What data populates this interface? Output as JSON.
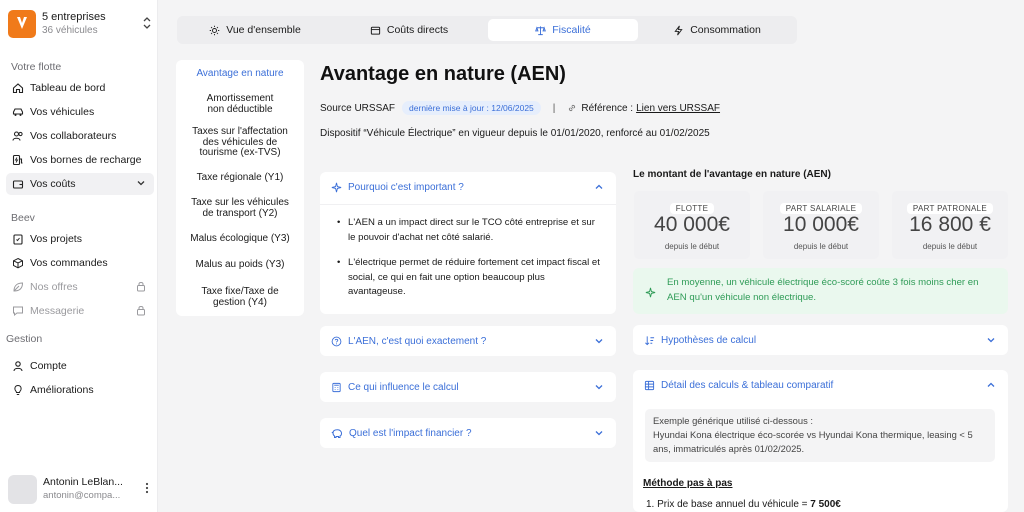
{
  "org": {
    "name": "5 entreprises",
    "sub": "36 véhicules"
  },
  "sidebar": {
    "section1": "Votre flotte",
    "items1": [
      {
        "label": "Tableau de bord",
        "icon": "home-icon"
      },
      {
        "label": "Vos véhicules",
        "icon": "car-icon"
      },
      {
        "label": "Vos collaborateurs",
        "icon": "users-icon"
      },
      {
        "label": "Vos bornes de recharge",
        "icon": "charger-icon"
      },
      {
        "label": "Vos coûts",
        "icon": "wallet-icon"
      }
    ],
    "section2": "Beev",
    "items2": [
      {
        "label": "Vos projets",
        "icon": "clipboard-icon"
      },
      {
        "label": "Vos commandes",
        "icon": "box-icon"
      },
      {
        "label": "Nos offres",
        "icon": "leaf-icon"
      },
      {
        "label": "Messagerie",
        "icon": "chat-icon"
      }
    ],
    "section3": "Gestion",
    "items3": [
      {
        "label": "Compte",
        "icon": "user-icon"
      },
      {
        "label": "Améliorations",
        "icon": "bulb-icon"
      }
    ]
  },
  "user": {
    "name": "Antonin LeBlan...",
    "email": "antonin@compa..."
  },
  "tabs": [
    {
      "label": "Vue d'ensemble"
    },
    {
      "label": "Coûts directs"
    },
    {
      "label": "Fiscalité"
    },
    {
      "label": "Consommation"
    }
  ],
  "subnav": [
    "Avantage en nature",
    "Amortissement non déductible",
    "Taxes sur l'affectation des véhicules de tourisme (ex-TVS)",
    "Taxe régionale (Y1)",
    "Taxe sur les véhicules de transport (Y2)",
    "Malus écologique (Y3)",
    "Malus au poids (Y3)",
    "Taxe fixe/Taxe de gestion (Y4)"
  ],
  "main": {
    "title": "Avantage en nature (AEN)",
    "source": "Source URSSAF",
    "update_badge": "dernière mise à jour : 12/06/2025",
    "separator": "|",
    "reference_label": "Référence :",
    "reference_link": "Lien vers URSSAF",
    "dispositif_prefix": "Dispositif “Véhicule Électrique” en vigueur depuis le ",
    "dispositif_date1": "01/01/2020",
    "dispositif_mid": ", renforcé au ",
    "dispositif_date2": "01/02/2025"
  },
  "accordions": {
    "why": {
      "title": "Pourquoi c'est important ?",
      "bullets": [
        "L'AEN a un impact direct sur le TCO côté entreprise et sur le pouvoir d'achat net côté salarié.",
        "L'électrique permet de réduire fortement cet impact fiscal et social, ce qui en fait une option beaucoup plus avantageuse."
      ]
    },
    "what": {
      "title": "L'AEN, c'est quoi exactement ?"
    },
    "influence": {
      "title": "Ce qui influence le calcul"
    },
    "impact": {
      "title": "Quel est l'impact financier ?"
    },
    "hypotheses": {
      "title": "Hypothèses de calcul"
    },
    "details": {
      "title": "Détail des calculs & tableau comparatif"
    }
  },
  "aen": {
    "title": "Le montant de l'avantage en nature (AEN)",
    "stats": [
      {
        "label": "FLOTTE",
        "value": "40 000€",
        "sub": "depuis le début"
      },
      {
        "label": "PART SALARIALE",
        "value": "10 000€",
        "sub": "depuis le début"
      },
      {
        "label": "PART PATRONALE",
        "value": "16 800 €",
        "sub": "depuis le début"
      }
    ],
    "green_text": "En moyenne, un véhicule électrique éco-scoré coûte 3 fois moins cher en AEN qu'un véhicule non électrique."
  },
  "example": {
    "line1": "Exemple générique utilisé ci-dessous :",
    "line2": "Hyundai Kona électrique éco-scorée vs Hyundai Kona thermique, leasing < 5 ans, immatriculés après 01/02/2025."
  },
  "method": {
    "title": "Méthode pas à pas",
    "step1_prefix": "1. Prix de base annuel du véhicule = ",
    "step1_value": "7 500€"
  },
  "colors": {
    "accent": "#3b6fd8",
    "brand": "#f07a1a",
    "success": "#2f9b57"
  }
}
